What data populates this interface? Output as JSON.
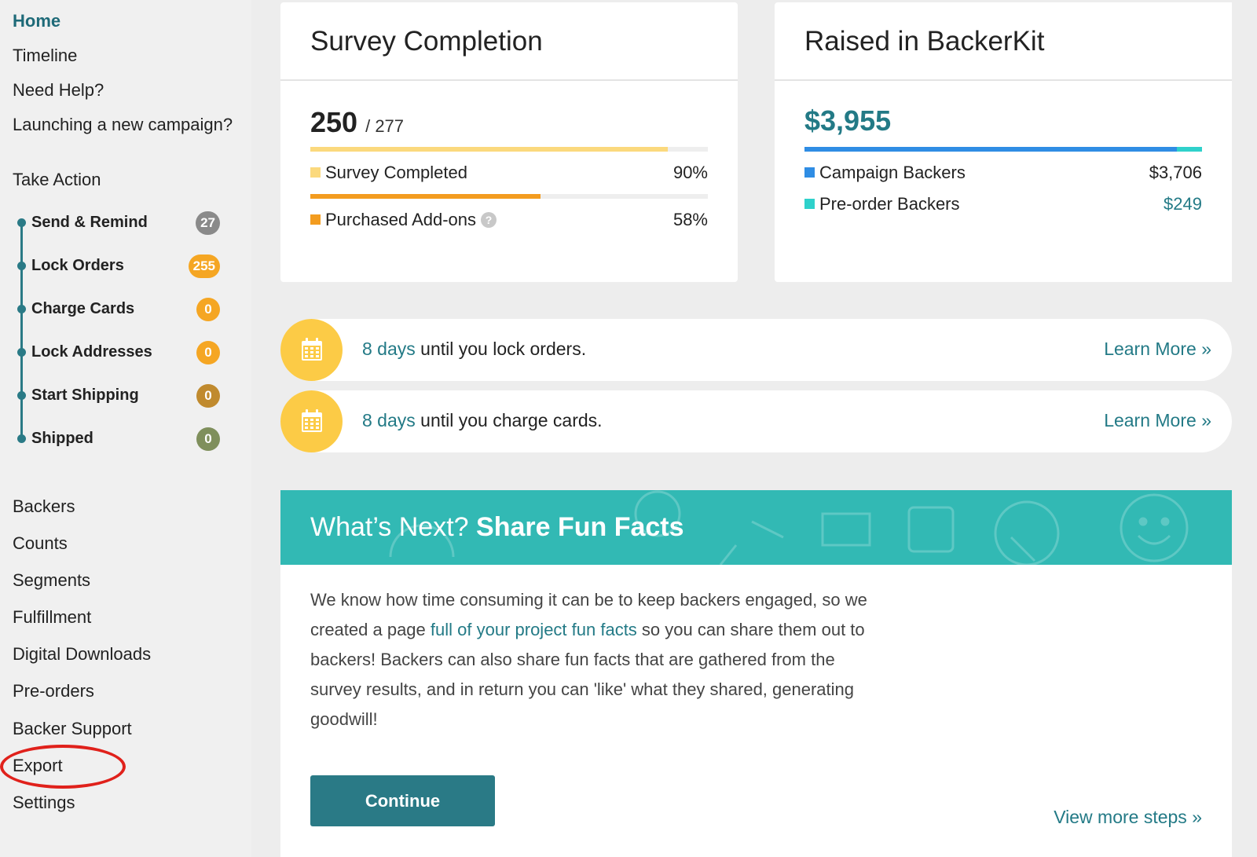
{
  "sidebar": {
    "top_links": [
      "Home",
      "Timeline",
      "Need Help?",
      "Launching a new campaign?"
    ],
    "take_action_title": "Take Action",
    "steps": [
      {
        "label": "Send & Remind",
        "count": "27",
        "color": "#8a8a8a"
      },
      {
        "label": "Lock Orders",
        "count": "255",
        "color": "#f5a623"
      },
      {
        "label": "Charge Cards",
        "count": "0",
        "color": "#f5a623"
      },
      {
        "label": "Lock Addresses",
        "count": "0",
        "color": "#f5a623"
      },
      {
        "label": "Start Shipping",
        "count": "0",
        "color": "#c08a2e"
      },
      {
        "label": "Shipped",
        "count": "0",
        "color": "#7f8f5c"
      }
    ],
    "bottom_links": [
      "Backers",
      "Counts",
      "Segments",
      "Fulfillment",
      "Digital Downloads",
      "Pre-orders",
      "Backer Support",
      "Export",
      "Settings"
    ]
  },
  "survey_card": {
    "title": "Survey Completion",
    "completed": "250",
    "total": "/ 277",
    "rows": [
      {
        "label": "Survey Completed",
        "percent": "90%",
        "fill": 0.9,
        "color": "#fbd97d"
      },
      {
        "label": "Purchased Add-ons",
        "percent": "58%",
        "fill": 0.58,
        "color": "#f39c1f",
        "help_icon": "?"
      }
    ]
  },
  "raised_card": {
    "title": "Raised in BackerKit",
    "total": "$3,955",
    "bar": {
      "campaign_fraction": 0.937,
      "campaign_color": "#2f8de4",
      "preorder_color": "#2fd1cb"
    },
    "rows": [
      {
        "label": "Campaign Backers",
        "amount": "$3,706",
        "color": "#2f8de4"
      },
      {
        "label": "Pre-order Backers",
        "amount": "$249",
        "color": "#2fd1cb"
      }
    ]
  },
  "reminders": [
    {
      "highlight": "8 days",
      "text": " until you lock orders.",
      "link": "Learn More »",
      "icon": "calendar-icon"
    },
    {
      "highlight": "8 days",
      "text": " until you charge cards.",
      "link": "Learn More »",
      "icon": "calendar-icon"
    }
  ],
  "whats_next": {
    "title_light": "What’s Next?",
    "title_bold": "Share Fun Facts",
    "para_1": "We know how time consuming it can be to keep backers engaged, so we created a page ",
    "para_link": "full of your project fun facts",
    "para_2": " so you can share them out to backers! Backers can also share fun facts that are gathered from the survey results, and in return you can 'like' what they shared, generating goodwill!",
    "button": "Continue",
    "view_more": "View more steps »"
  },
  "colors": {
    "accent": "#237a86",
    "banner": "#32b9b4",
    "annotation": "#e0211b"
  }
}
